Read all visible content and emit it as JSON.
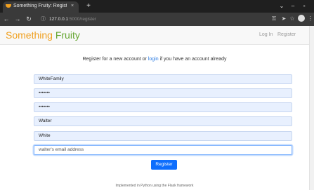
{
  "browser": {
    "tab_title": "Something Fruity: Register",
    "tab_close": "×",
    "new_tab": "+",
    "url_host": "127.0.0.1",
    "url_rest": ":5000/register",
    "window_controls": [
      "⌄",
      "–",
      "▫"
    ]
  },
  "site": {
    "brand_first": "Something",
    "brand_second": "Fruity",
    "nav": {
      "login": "Log In",
      "register": "Register"
    }
  },
  "form": {
    "prompt_before": "Register for a new account or ",
    "prompt_link": "login",
    "prompt_after": " if you have an account already",
    "fields": [
      {
        "name": "username",
        "value": "WhiteFamily"
      },
      {
        "name": "password",
        "value": "•••••••"
      },
      {
        "name": "confirm_password",
        "value": "•••••••"
      },
      {
        "name": "first_name",
        "value": "Walter"
      },
      {
        "name": "last_name",
        "value": "White"
      },
      {
        "name": "email",
        "placeholder": "walter's email address"
      }
    ],
    "submit_label": "Register"
  },
  "footer": "Implemented in Python using the Flask framework",
  "colors": {
    "brand_orange": "#f0a020",
    "brand_green": "#66a632",
    "primary": "#0d6efd",
    "link": "#2a7ae2"
  },
  "icons": [
    "back-icon",
    "forward-icon",
    "reload-icon",
    "info-icon",
    "key-icon",
    "send-icon",
    "star-icon",
    "profile-icon",
    "menu-icon"
  ]
}
